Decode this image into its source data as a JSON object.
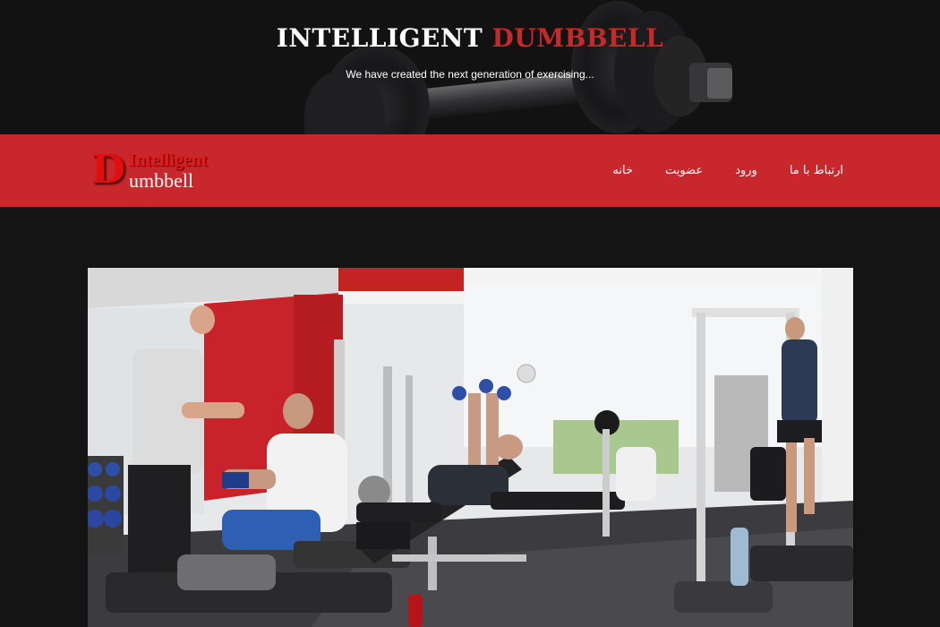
{
  "header": {
    "title_main": "INTELLIGENT",
    "title_accent": "DUMBBELL",
    "subtitle": "We have created the next generation of exercising..."
  },
  "logo": {
    "letter": "D",
    "word_top": "Intelligent",
    "word_bottom": "umbbell"
  },
  "nav": {
    "items": [
      {
        "label": "خانه"
      },
      {
        "label": "عضویت"
      },
      {
        "label": "ورود"
      },
      {
        "label": "ارتباط با ما"
      }
    ]
  },
  "hero_photo": {
    "subject": "gym-interior-photo"
  },
  "colors": {
    "brand_red": "#c8282b",
    "accent_red": "#c52a2b",
    "page_bg": "#141414"
  }
}
